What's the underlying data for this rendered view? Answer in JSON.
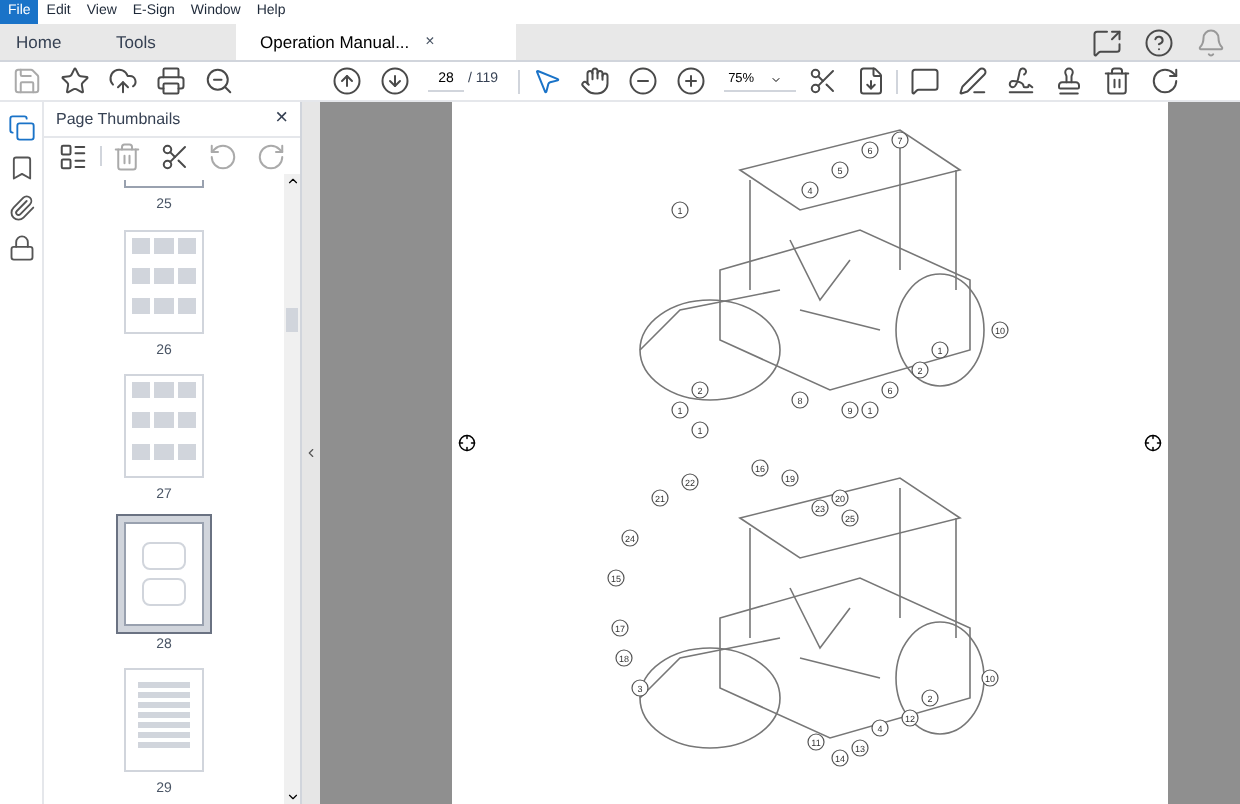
{
  "menu_bar": [
    {
      "label": "File",
      "selected": true
    },
    {
      "label": "Edit",
      "selected": false
    },
    {
      "label": "View",
      "selected": false
    },
    {
      "label": "E-Sign",
      "selected": false
    },
    {
      "label": "Window",
      "selected": false
    },
    {
      "label": "Help",
      "selected": false
    }
  ],
  "tabs": [
    {
      "label": "Home",
      "selected": false
    },
    {
      "label": "Tools",
      "selected": false
    },
    {
      "label": "Operation Manual...",
      "selected": true,
      "close": "×"
    }
  ],
  "toolbar": {
    "page_number": "28",
    "page_total": "/ 119",
    "zoom": "75%"
  },
  "side_rail": [
    {
      "kind": "thumbnails",
      "selected": true
    },
    {
      "kind": "bookmarks",
      "selected": false
    },
    {
      "kind": "attachments",
      "selected": false
    },
    {
      "kind": "security",
      "selected": false
    }
  ],
  "thumbnail_panel": {
    "title": "Page Thumbnails",
    "close": "×",
    "pages": [
      {
        "label": "25",
        "selected": false,
        "kind": "cut"
      },
      {
        "label": "26",
        "selected": false,
        "kind": "text"
      },
      {
        "label": "27",
        "selected": false,
        "kind": "text"
      },
      {
        "label": "28",
        "selected": true,
        "kind": "drawing"
      },
      {
        "label": "29",
        "selected": false,
        "kind": "list"
      }
    ]
  },
  "document": {
    "figures": [
      {
        "callouts": [
          "1",
          "4",
          "5",
          "6",
          "7",
          "1",
          "2",
          "1",
          "8",
          "9",
          "1",
          "6",
          "2",
          "1",
          "10"
        ]
      },
      {
        "callouts": [
          "21",
          "22",
          "16",
          "19",
          "20",
          "23",
          "25",
          "24",
          "15",
          "17",
          "18",
          "3",
          "2",
          "12",
          "10",
          "4",
          "13",
          "14",
          "11"
        ]
      }
    ]
  }
}
